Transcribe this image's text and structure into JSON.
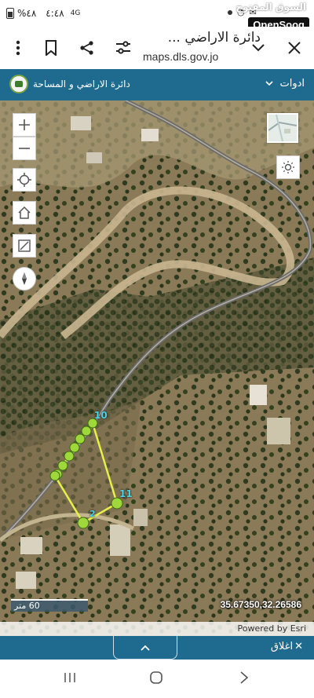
{
  "status_bar": {
    "time": "٤:٤٨",
    "battery": "%٤٨",
    "network": "4G"
  },
  "watermark": {
    "arabic": "السوق المفتوح",
    "brand": "OpenSooq"
  },
  "browser": {
    "page_title": "دائرة الاراضي ...",
    "url": "maps.dls.gov.jo"
  },
  "app_header": {
    "brand_name": "دائرة الاراضي و المساحة",
    "tools_menu_label": "ادوات"
  },
  "map": {
    "scale_label": "60 متر",
    "coordinates": "35.67350,32.26586",
    "attribution": "Powered by Esri",
    "parcel_labels": {
      "vertex_a": "10",
      "vertex_b": "11",
      "vertex_c": "2"
    },
    "colors": {
      "parcel_line": "#e6f04a",
      "vertex_fill": "#9fd83a",
      "label": "#48d4e8"
    }
  },
  "bottom_panel": {
    "close_label": "اغلاق"
  },
  "icons": {
    "close": "close-icon",
    "share": "share-icon",
    "bookmark": "bookmark-icon",
    "menu": "more-vert-icon",
    "tune": "tune-icon"
  }
}
